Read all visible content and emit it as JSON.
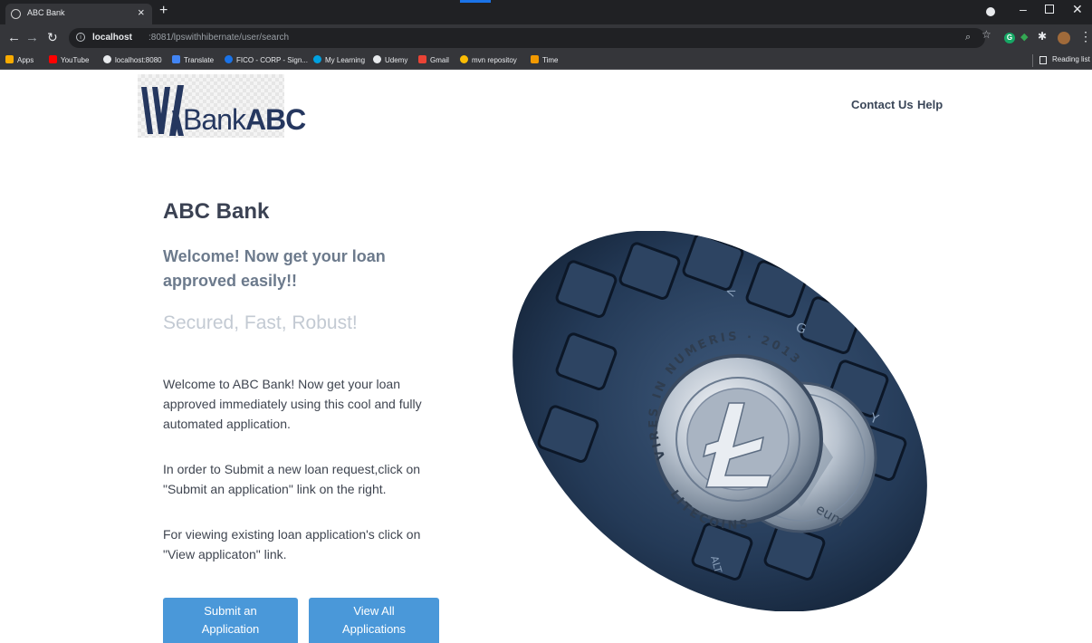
{
  "browser": {
    "tab_title": "ABC Bank",
    "tab_close": "×",
    "new_tab": "+",
    "url_host": "localhost",
    "url_path": ":8081/lpswithhibernate/user/search",
    "bookmarks": [
      "Apps",
      "YouTube",
      "localhost:8080",
      "Translate",
      "FICO - CORP - Sign...",
      "My Learning",
      "Udemy",
      "Gmail",
      "mvn repositoy",
      "Time"
    ],
    "reading_list": "Reading list"
  },
  "logo": {
    "text_light": "Bank",
    "text_bold": "ABC"
  },
  "nav": {
    "contact": "Contact Us",
    "help": "Help"
  },
  "main": {
    "title": "ABC Bank",
    "welcome": "Welcome! Now get your loan approved easily!!",
    "tagline": "Secured, Fast, Robust!",
    "para1": "Welcome to ABC Bank! Now get your loan approved immediately using this cool and fully automated application.",
    "para2": "In order to Submit a new loan request,click on \"Submit an application\" link on the right.",
    "para3": "For viewing existing loan application's click on \"View applicaton\" link.",
    "submit_line1": "Submit an",
    "submit_line2": "Application",
    "view_line1": "View All",
    "view_line2": "Applications"
  },
  "hero": {
    "coin_text_top": "VIRES IN NUMERIS · 2013",
    "coin_text_bottom": "LITECOINS",
    "coin2_text": "eum",
    "key_text": "ALT"
  },
  "colors": {
    "accent_button": "#4a98d9",
    "brand_navy": "#25375f",
    "tagline": "#c3cad3"
  }
}
